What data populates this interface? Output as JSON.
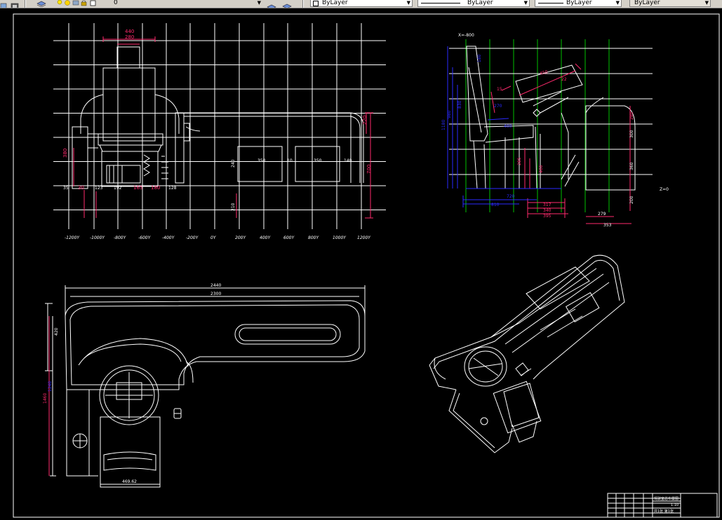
{
  "toolbar": {
    "layer_name": "0",
    "color_value": "ByLayer",
    "linetype_value": "ByLayer",
    "lineweight_value": "ByLayer",
    "plotstyle_value": "ByLayer"
  },
  "drawing": {
    "front_view": {
      "x_ticks": [
        "-1200Y",
        "-1000Y",
        "-800Y",
        "-600Y",
        "-400Y",
        "-200Y",
        "0Y",
        "200Y",
        "400Y",
        "600Y",
        "800Y",
        "1000Y",
        "1200Y"
      ],
      "dims": {
        "top_width_outer": "440",
        "top_width_inner": "280",
        "left_height": "380",
        "panel_depth": "210",
        "right_height": "700",
        "right_top": "220",
        "panel_a": "350",
        "panel_gap": "10",
        "panel_b": "350",
        "panel_right": "140",
        "panel_height": "240",
        "bottom_a": "35",
        "bottom_b": "30",
        "bottom_c": "123",
        "bottom_d": "192",
        "bottom_e": "165",
        "bottom_f": "180",
        "bottom_g": "128"
      }
    },
    "side_view": {
      "x_label": "X=-800",
      "z_label": "Z=0",
      "dims": {
        "seat_back_top": "180",
        "seat_back_h": "830",
        "seat_h": "980",
        "seat_total": "1180",
        "seat_depth": "400",
        "seat_angle": "270",
        "wheel_len": "450",
        "wheel_angle": "22",
        "angle_a": "15",
        "h_285": "285",
        "h_460": "460",
        "right_200": "280",
        "right_300": "300",
        "right_360": "360",
        "bottom_720": "720",
        "bottom_810": "810",
        "bottom_317": "317",
        "bottom_340": "340",
        "bottom_395": "395",
        "bottom_279": "279",
        "bottom_353": "353",
        "right_200b": "200"
      }
    },
    "plan_view": {
      "overall_width": "2440",
      "inner_width": "2300",
      "left_depth_a": "420",
      "left_depth_b": "1460",
      "left_depth_c": "1240",
      "seat_width": "469.62"
    },
    "title_block": {
      "drawing_name": "驾驶室总布置图",
      "scale": "1:10",
      "sheet": "共1张 第1张"
    }
  }
}
